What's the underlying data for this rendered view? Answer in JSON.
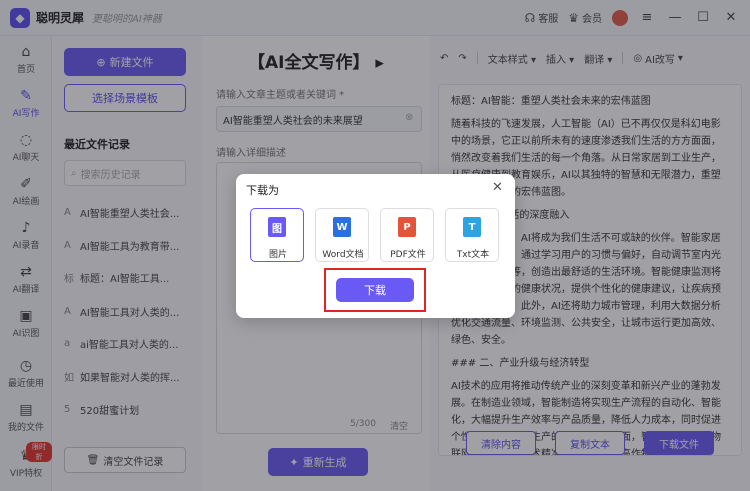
{
  "app": {
    "name": "聪明灵犀",
    "slogan": "更聪明的AI神器"
  },
  "titlebar": {
    "contact": "客服",
    "vip": "会员"
  },
  "nav": [
    {
      "label": "首页",
      "icon": "home-icon",
      "glyph": "⌂"
    },
    {
      "label": "AI写作",
      "icon": "write-icon",
      "glyph": "✎",
      "active": true
    },
    {
      "label": "AI聊天",
      "icon": "chat-icon",
      "glyph": "◌"
    },
    {
      "label": "AI绘画",
      "icon": "paint-icon",
      "glyph": "✐"
    },
    {
      "label": "AI录音",
      "icon": "mic-icon",
      "glyph": "♪"
    },
    {
      "label": "AI翻译",
      "icon": "translate-icon",
      "glyph": "⇄"
    },
    {
      "label": "AI识图",
      "icon": "scan-icon",
      "glyph": "▣"
    },
    {
      "label": "最近使用",
      "icon": "clock-icon",
      "glyph": "◷"
    },
    {
      "label": "我的文件",
      "icon": "folder-icon",
      "glyph": "▤"
    },
    {
      "label": "VIP特权",
      "icon": "vip-icon",
      "glyph": "♛",
      "badge": "限时折"
    }
  ],
  "files": {
    "new_file": "新建文件",
    "scene_template": "选择场景模板",
    "recent_title": "最近文件记录",
    "search_placeholder": "搜索历史记录",
    "items": [
      {
        "label": "AI智能重塑人类社会...",
        "icon": "A"
      },
      {
        "label": "AI智能工具为教育带...",
        "icon": "A"
      },
      {
        "label": "标题：AI智能工具...",
        "icon": "标"
      },
      {
        "label": "AI智能工具对人类的...",
        "icon": "A"
      },
      {
        "label": "ai智能工具对人类的...",
        "icon": "a"
      },
      {
        "label": "如果智能对人类的挥...",
        "icon": "如"
      },
      {
        "label": "520甜蜜计划",
        "icon": "5"
      }
    ],
    "clear_history": "清空文件记录"
  },
  "middle": {
    "title": "【AI全文写作】",
    "topic_label": "请输入文章主题或者关键词 *",
    "topic_value": "AI智能重塑人类社会的未来展望",
    "detail_label": "请输入详细描述",
    "char_count": "5/300",
    "clear": "清空",
    "regenerate": "重新生成"
  },
  "right": {
    "toolbar": {
      "style": "文本样式",
      "insert": "插入",
      "translate": "翻译",
      "rewrite": "AI改写"
    },
    "paragraphs": [
      "标题：AI智能：重塑人类社会未来的宏伟蓝图",
      "随着科技的飞速发展，人工智能（AI）已不再仅仅是科幻电影中的场景，它正以前所未有的速度渗透我们生活的方方面面，悄然改变着我们生活的每一个角落。从日常家居到工业生产，从医疗健康到教育娱乐，AI以其独特的智慧和无限潜力，重塑人类社会未来的宏伟蓝图。",
      "### 一、生活的深度融入",
      "在日常生活中，AI将成为我们生活不可或缺的伙伴。智能家居系统全面升级，通过学习用户的习惯与偏好，自动调节室内光线、娱乐内容等，创造出最舒适的生活环境。智能健康监测将实时监测用户的健康状况，提供个性化的健康建议，让疾病预防更加前置化。此外，AI还将助力城市管理，利用大数据分析优化交通流量、环境监测、公共安全，让城市运行更加高效、绿色、安全。",
      "### 二、产业升级与经济转型",
      "AI技术的应用将推动传统产业的深刻变革和新兴产业的蓬勃发展。在制造业领域，智能制造将实现生产流程的自动化、智能化，大幅提升生产效率与产品质量，降低人力成本，同时促进个性化定制和柔性生产的发展。农业方面，智能农业将利用物联网、大数据等技术精准管理农田，提高作物产量与品质。"
    ],
    "clear_content": "清除内容",
    "copy_text": "复制文本",
    "download_file": "下载文件"
  },
  "dialog": {
    "title": "下载为",
    "formats": [
      {
        "label": "图片",
        "icon": "image-icon",
        "glyph": "图",
        "color": "#6a5af5",
        "selected": true
      },
      {
        "label": "Word文档",
        "icon": "word-icon",
        "glyph": "W",
        "color": "#2b6fe0"
      },
      {
        "label": "PDF文件",
        "icon": "pdf-icon",
        "glyph": "P",
        "color": "#e2543b"
      },
      {
        "label": "Txt文本",
        "icon": "txt-icon",
        "glyph": "T",
        "color": "#2ba4e0"
      }
    ],
    "download": "下载"
  }
}
